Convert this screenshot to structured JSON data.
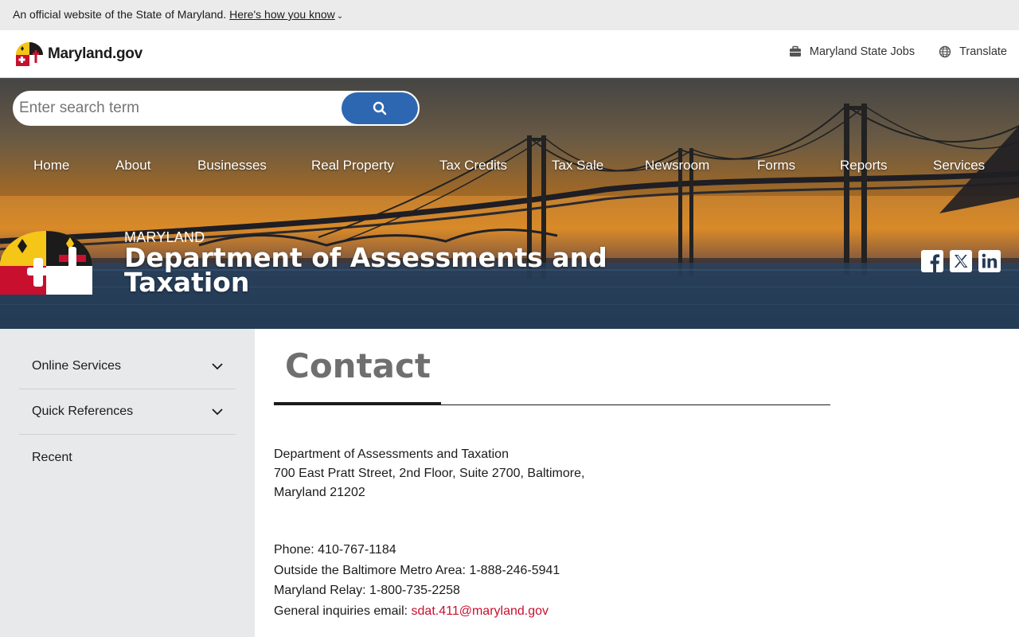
{
  "official_bar": {
    "text": "An official website of the State of Maryland.",
    "link": "Here's how you know",
    "chevron": "⌄"
  },
  "header": {
    "brand": "Maryland.gov",
    "links": [
      {
        "label": "Maryland State Jobs",
        "icon": "briefcase-icon"
      },
      {
        "label": "Translate",
        "icon": "globe-icon"
      }
    ]
  },
  "search": {
    "placeholder": "Enter search term",
    "icon": "search-icon"
  },
  "nav": [
    "Home",
    "About",
    "Businesses",
    "Real Property",
    "Tax Credits",
    "Tax Sale",
    "Newsroom",
    "Forms",
    "Reports",
    "Services"
  ],
  "agency": {
    "kicker": "MARYLAND",
    "title": "Department of Assessments and Taxation"
  },
  "socials": [
    "facebook-icon",
    "x-twitter-icon",
    "linkedin-icon"
  ],
  "sidebar": {
    "items": [
      {
        "label": "Online Services",
        "expandable": true
      },
      {
        "label": "Quick References",
        "expandable": true
      },
      {
        "label": "Recent",
        "expandable": false
      }
    ]
  },
  "content": {
    "title": "Contact",
    "address": [
      "Department of Assessments and Taxation",
      "700 East Pratt Street, 2nd Floor, Suite 2700, Baltimore,",
      "Maryland 21202"
    ],
    "phone": "Phone: 410-767-1184",
    "outside": "Outside the Baltimore Metro Area: 1-888-246-5941",
    "relay": "Maryland Relay: 1-800-735-2258",
    "email_label": "General inquiries email:",
    "email": "sdat.411@maryland.gov"
  },
  "colors": {
    "accent_blue": "#2e67b1",
    "link_red": "#c8102e",
    "sidebar_bg": "#e8e9ea",
    "title_gray": "#6f6f6f"
  }
}
